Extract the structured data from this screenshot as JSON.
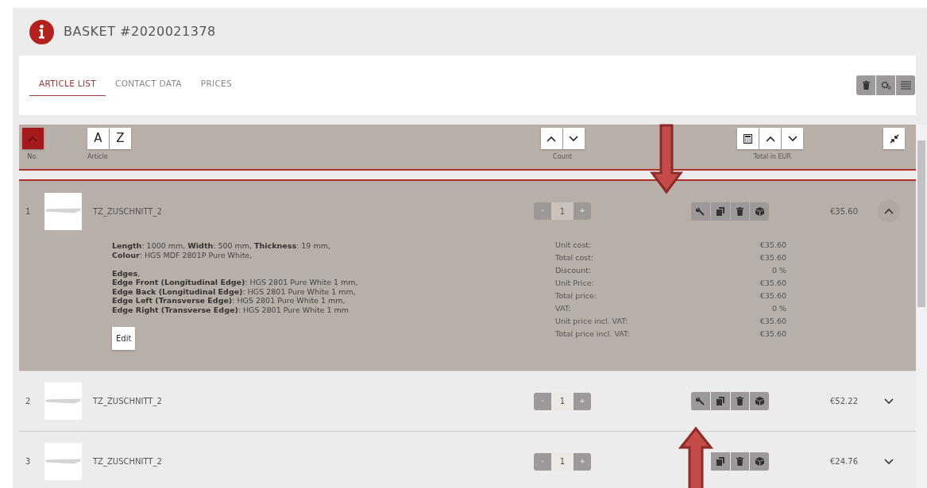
{
  "header": {
    "title": "BASKET #2020021378"
  },
  "tabs": [
    {
      "label": "ARTICLE LIST",
      "selected": true
    },
    {
      "label": "CONTACT DATA",
      "selected": false
    },
    {
      "label": "PRICES",
      "selected": false
    }
  ],
  "table": {
    "columns": [
      "No.",
      "Article",
      "Count",
      "Total in EUR"
    ],
    "sort_letters": [
      "A",
      "Z"
    ],
    "no_sort_active": true
  },
  "rows": [
    {
      "no": "1",
      "name": "TZ_ZUSCHNITT_2",
      "decrement": "-",
      "count": "1",
      "increment": "+",
      "total": "€35.60",
      "expanded": true,
      "details": [
        [
          "**Length**: 1000 mm, **Width**: 500 mm, **Thickness**: 19 mm,",
          "**Colour**: HGS MDF 2801P Pure White,"
        ],
        [
          "**Edges**,",
          "**Edge Front (Longitudinal Edge)**: HGS 2801 Pure White 1 mm,",
          "**Edge Back (Longitudinal Edge)**: HGS 2801 Pure White 1 mm,",
          "**Edge Left (Transverse Edge)**: HGS 2801 Pure White 1 mm,",
          "**Edge Right (Transverse Edge)**: HGS 2801 Pure White 1 mm"
        ]
      ],
      "edit_label": "Edit",
      "prices": [
        {
          "label": "Unit cost:",
          "value": "€35.60"
        },
        {
          "label": "Total cost:",
          "value": "€35.60"
        },
        {
          "label": "Discount:",
          "value": "0 %"
        },
        {
          "label": "Unit Price:",
          "value": "€35.60"
        },
        {
          "label": "Total price:",
          "value": "€35.60"
        },
        {
          "label": "VAT:",
          "value": "0 %"
        },
        {
          "label": "Unit price incl. VAT:",
          "value": "€35.60"
        },
        {
          "label": "Total price incl. VAT:",
          "value": "€35.60"
        }
      ]
    },
    {
      "no": "2",
      "name": "TZ_ZUSCHNITT_2",
      "decrement": "-",
      "count": "1",
      "increment": "+",
      "total": "€52.22",
      "expanded": false
    },
    {
      "no": "3",
      "name": "TZ_ZUSCHNITT_2",
      "decrement": "-",
      "count": "1",
      "increment": "+",
      "total": "€24.76",
      "expanded": false,
      "configure_covered": true
    }
  ]
}
